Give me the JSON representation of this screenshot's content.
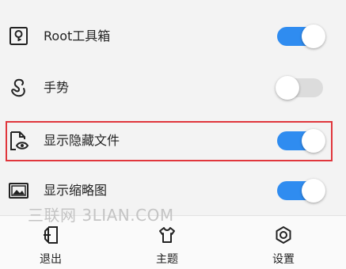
{
  "settings": {
    "items": [
      {
        "label": "Root工具箱",
        "icon": "root-toolbox-icon",
        "enabled": true
      },
      {
        "label": "手势",
        "icon": "gesture-icon",
        "enabled": false
      },
      {
        "label": "显示隐藏文件",
        "icon": "hidden-file-icon",
        "enabled": true
      },
      {
        "label": "显示缩略图",
        "icon": "thumbnail-icon",
        "enabled": true
      }
    ]
  },
  "watermark": "三联网 3LIAN.COM",
  "bottom_nav": {
    "exit_label": "退出",
    "theme_label": "主题",
    "settings_label": "设置"
  },
  "colors": {
    "toggle_on": "#2f8cf0",
    "toggle_off": "#dcdcdc",
    "highlight": "#e0363c"
  }
}
